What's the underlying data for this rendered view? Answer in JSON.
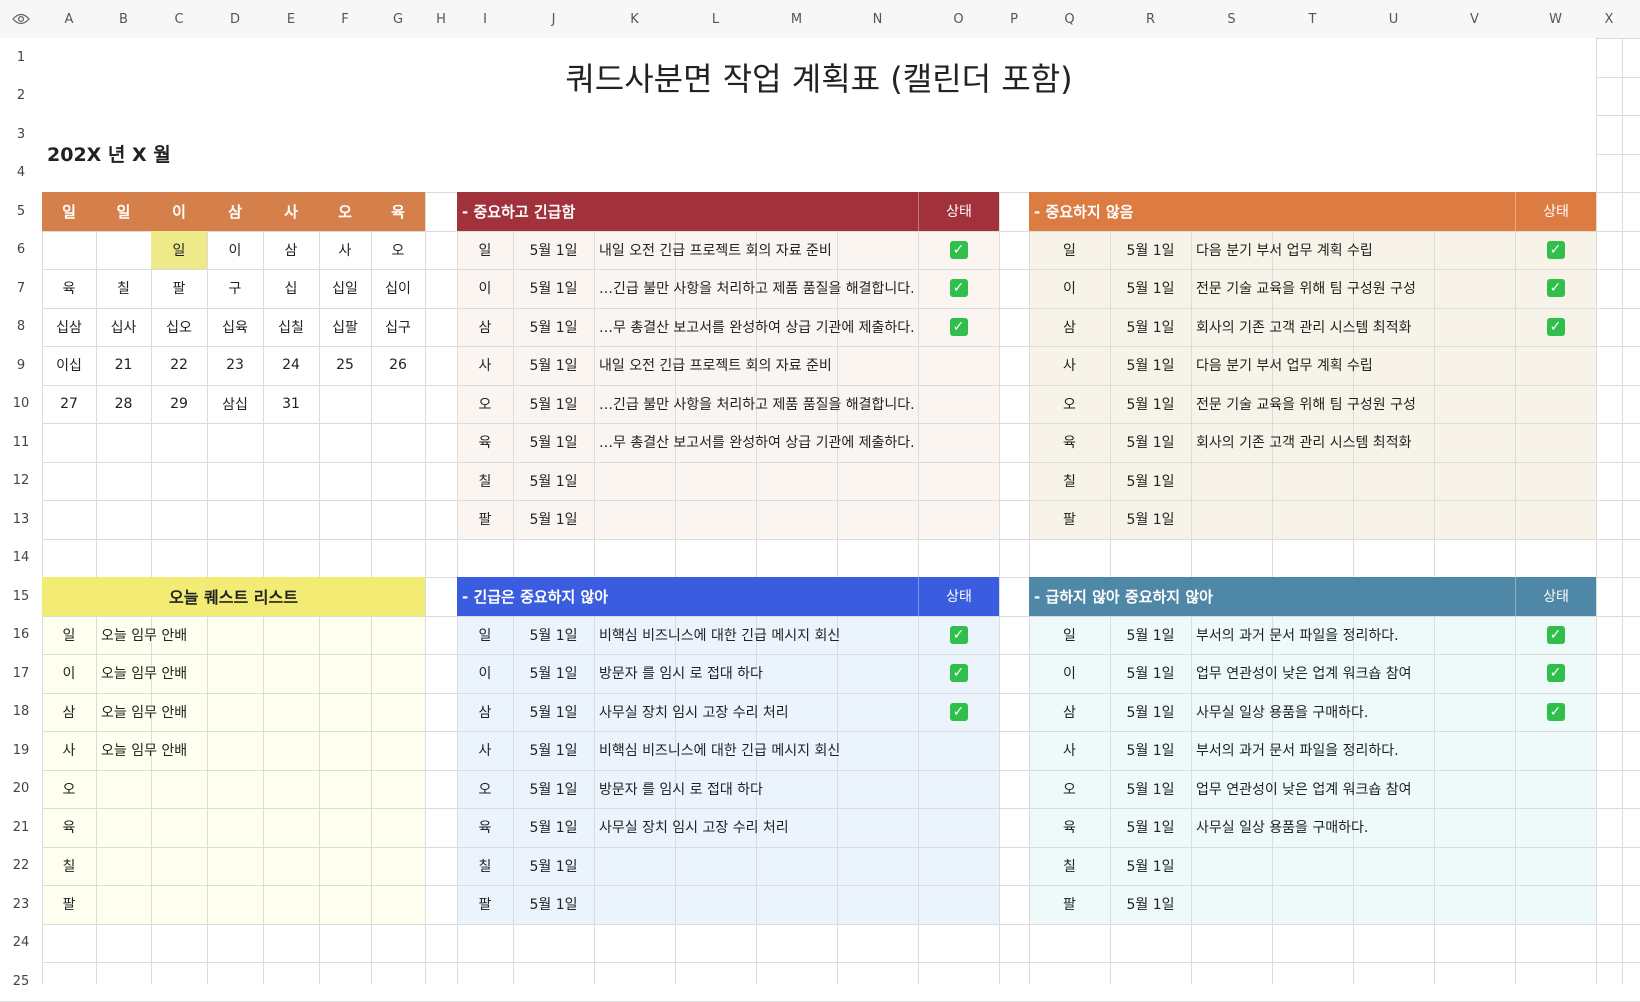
{
  "sheet": {
    "title": "쿼드사분면 작업 계획표 (캘린더 포함)",
    "period": "202X 년 X 월",
    "columns": [
      "A",
      "B",
      "C",
      "D",
      "E",
      "F",
      "G",
      "H",
      "I",
      "J",
      "K",
      "L",
      "M",
      "N",
      "O",
      "P",
      "Q",
      "R",
      "S",
      "T",
      "U",
      "V",
      "W",
      "X"
    ],
    "rows": [
      "1",
      "2",
      "3",
      "4",
      "5",
      "6",
      "7",
      "8",
      "9",
      "10",
      "11",
      "12",
      "13",
      "14",
      "15",
      "16",
      "17",
      "18",
      "19",
      "20",
      "21",
      "22",
      "23",
      "24",
      "25"
    ]
  },
  "calendar": {
    "weekdays": [
      "일",
      "일",
      "이",
      "삼",
      "사",
      "오",
      "육"
    ],
    "weeks": [
      [
        "",
        "",
        "일",
        "이",
        "삼",
        "사",
        "오"
      ],
      [
        "육",
        "칠",
        "팔",
        "구",
        "십",
        "십일",
        "십이"
      ],
      [
        "십삼",
        "십사",
        "십오",
        "십육",
        "십칠",
        "십팔",
        "십구"
      ],
      [
        "이십",
        "21",
        "22",
        "23",
        "24",
        "25",
        "26"
      ],
      [
        "27",
        "28",
        "29",
        "삼십",
        "31",
        "",
        ""
      ]
    ]
  },
  "quests": {
    "title": "오늘 퀘스트 리스트",
    "items": [
      {
        "n": "일",
        "text": "오늘 임무 안배"
      },
      {
        "n": "이",
        "text": "오늘 임무 안배"
      },
      {
        "n": "삼",
        "text": "오늘 임무 안배"
      },
      {
        "n": "사",
        "text": "오늘 임무 안배"
      },
      {
        "n": "오",
        "text": ""
      },
      {
        "n": "육",
        "text": ""
      },
      {
        "n": "칠",
        "text": ""
      },
      {
        "n": "팔",
        "text": ""
      }
    ]
  },
  "quadrants": [
    {
      "title": "- 중요하고 긴급함",
      "status": "상태",
      "rows": [
        {
          "n": "일",
          "date": "5월 1일",
          "task": "내일 오전 긴급 프로젝트 회의 자료 준비",
          "done": true
        },
        {
          "n": "이",
          "date": "5월 1일",
          "task": "…긴급 불만 사항을 처리하고 제품 품질을 해결합니다.",
          "done": true
        },
        {
          "n": "삼",
          "date": "5월 1일",
          "task": "…무 총결산 보고서를 완성하여 상급 기관에 제출하다.",
          "done": true
        },
        {
          "n": "사",
          "date": "5월 1일",
          "task": "내일 오전 긴급 프로젝트 회의 자료 준비",
          "done": false
        },
        {
          "n": "오",
          "date": "5월 1일",
          "task": "…긴급 불만 사항을 처리하고 제품 품질을 해결합니다.",
          "done": false
        },
        {
          "n": "육",
          "date": "5월 1일",
          "task": "…무 총결산 보고서를 완성하여 상급 기관에 제출하다.",
          "done": false
        },
        {
          "n": "칠",
          "date": "5월 1일",
          "task": "",
          "done": false
        },
        {
          "n": "팔",
          "date": "5월 1일",
          "task": "",
          "done": false
        }
      ]
    },
    {
      "title": "- 중요하지 않음",
      "status": "상태",
      "rows": [
        {
          "n": "일",
          "date": "5월 1일",
          "task": "다음 분기 부서 업무 계획 수립",
          "done": true
        },
        {
          "n": "이",
          "date": "5월 1일",
          "task": "전문 기술 교육을 위해 팀 구성원 구성",
          "done": true
        },
        {
          "n": "삼",
          "date": "5월 1일",
          "task": "회사의 기존 고객 관리 시스템 최적화",
          "done": true
        },
        {
          "n": "사",
          "date": "5월 1일",
          "task": "다음 분기 부서 업무 계획 수립",
          "done": false
        },
        {
          "n": "오",
          "date": "5월 1일",
          "task": "전문 기술 교육을 위해 팀 구성원 구성",
          "done": false
        },
        {
          "n": "육",
          "date": "5월 1일",
          "task": "회사의 기존 고객 관리 시스템 최적화",
          "done": false
        },
        {
          "n": "칠",
          "date": "5월 1일",
          "task": "",
          "done": false
        },
        {
          "n": "팔",
          "date": "5월 1일",
          "task": "",
          "done": false
        }
      ]
    },
    {
      "title": "- 긴급은 중요하지 않아",
      "status": "상태",
      "rows": [
        {
          "n": "일",
          "date": "5월 1일",
          "task": "비핵심 비즈니스에 대한 긴급 메시지 회신",
          "done": true
        },
        {
          "n": "이",
          "date": "5월 1일",
          "task": "방문자 를 임시 로 접대 하다",
          "done": true
        },
        {
          "n": "삼",
          "date": "5월 1일",
          "task": "사무실 장치 임시 고장 수리 처리",
          "done": true
        },
        {
          "n": "사",
          "date": "5월 1일",
          "task": "비핵심 비즈니스에 대한 긴급 메시지 회신",
          "done": false
        },
        {
          "n": "오",
          "date": "5월 1일",
          "task": "방문자 를 임시 로 접대 하다",
          "done": false
        },
        {
          "n": "육",
          "date": "5월 1일",
          "task": "사무실 장치 임시 고장 수리 처리",
          "done": false
        },
        {
          "n": "칠",
          "date": "5월 1일",
          "task": "",
          "done": false
        },
        {
          "n": "팔",
          "date": "5월 1일",
          "task": "",
          "done": false
        }
      ]
    },
    {
      "title": "- 급하지 않아 중요하지 않아",
      "status": "상태",
      "rows": [
        {
          "n": "일",
          "date": "5월 1일",
          "task": "부서의 과거 문서 파일을 정리하다.",
          "done": true
        },
        {
          "n": "이",
          "date": "5월 1일",
          "task": "업무 연관성이 낮은 업계 워크숍 참여",
          "done": true
        },
        {
          "n": "삼",
          "date": "5월 1일",
          "task": "사무실 일상 용품을 구매하다.",
          "done": true
        },
        {
          "n": "사",
          "date": "5월 1일",
          "task": "부서의 과거 문서 파일을 정리하다.",
          "done": false
        },
        {
          "n": "오",
          "date": "5월 1일",
          "task": "업무 연관성이 낮은 업계 워크숍 참여",
          "done": false
        },
        {
          "n": "육",
          "date": "5월 1일",
          "task": "사무실 일상 용품을 구매하다.",
          "done": false
        },
        {
          "n": "칠",
          "date": "5월 1일",
          "task": "",
          "done": false
        },
        {
          "n": "팔",
          "date": "5월 1일",
          "task": "",
          "done": false
        }
      ]
    }
  ],
  "colors": {
    "calendar_header": "#d5804a",
    "today_highlight": "#eeea8a",
    "quest_header": "#f2ec74",
    "quest_body": "#fffff0",
    "q1_header": "#a1313a",
    "q1_body": "#fbf5f2",
    "q2_header": "#dc7b42",
    "q2_body": "#f8f3e8",
    "q3_header": "#3a5de0",
    "q3_body": "#ebf3fd",
    "q4_header": "#4f87a6",
    "q4_body": "#eef9fa",
    "check": "#2fbf4a"
  },
  "icons": {
    "corner": "eye-icon",
    "done": "check-icon"
  }
}
